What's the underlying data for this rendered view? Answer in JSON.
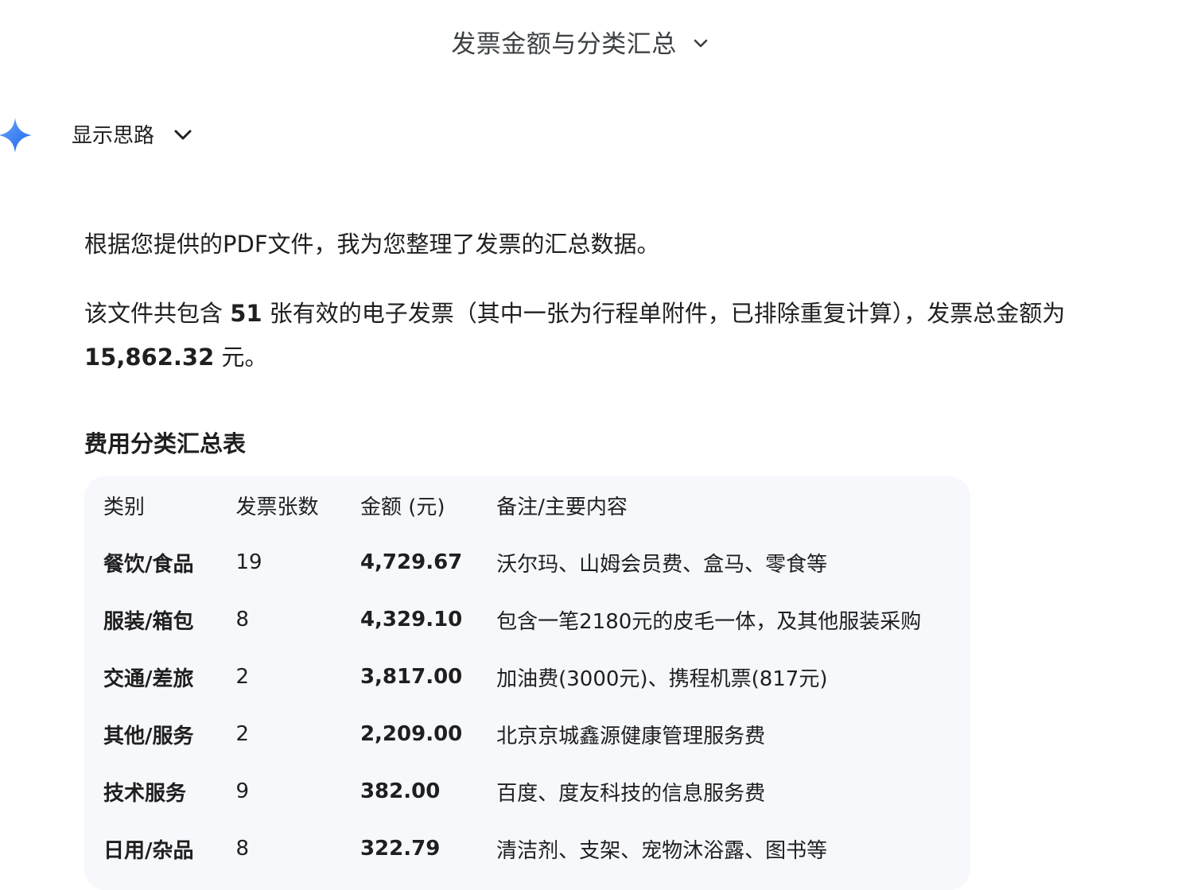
{
  "header": {
    "title": "发票金额与分类汇总",
    "chevron_icon": "chevron-down-icon"
  },
  "thoughts": {
    "label": "显示思路",
    "chevron_icon": "chevron-down-icon",
    "spark_icon": "gemini-spark-icon"
  },
  "intro": {
    "line1": "根据您提供的PDF文件，我为您整理了发票的汇总数据。",
    "line2_prefix": "该文件共包含 ",
    "invoice_count": "51",
    "line2_middle": " 张有效的电子发票（其中一张为行程单附件，已排除重复计算），发票总金额为",
    "total_amount": "15,862.32",
    "line2_suffix": " 元。"
  },
  "summary_table": {
    "heading": "费用分类汇总表",
    "columns": [
      "类别",
      "发票张数",
      "金额 (元)",
      "备注/主要内容"
    ],
    "rows": [
      {
        "category": "餐饮/食品",
        "count": "19",
        "amount": "4,729.67",
        "note": "沃尔玛、山姆会员费、盒马、零食等"
      },
      {
        "category": "服装/箱包",
        "count": "8",
        "amount": "4,329.10",
        "note": "包含一笔2180元的皮毛一体，及其他服装采购"
      },
      {
        "category": "交通/差旅",
        "count": "2",
        "amount": "3,817.00",
        "note": "加油费(3000元)、携程机票(817元)"
      },
      {
        "category": "其他/服务",
        "count": "2",
        "amount": "2,209.00",
        "note": "北京京城鑫源健康管理服务费"
      },
      {
        "category": "技术服务",
        "count": "9",
        "amount": "382.00",
        "note": "百度、度友科技的信息服务费"
      },
      {
        "category": "日用/杂品",
        "count": "8",
        "amount": "322.79",
        "note": "清洁剂、支架、宠物沐浴露、图书等"
      }
    ]
  },
  "colors": {
    "spark_gradient_start": "#4285f4",
    "spark_gradient_end": "#1a73e8",
    "table_background": "#f6f8fc",
    "text": "#1f1f1f"
  }
}
